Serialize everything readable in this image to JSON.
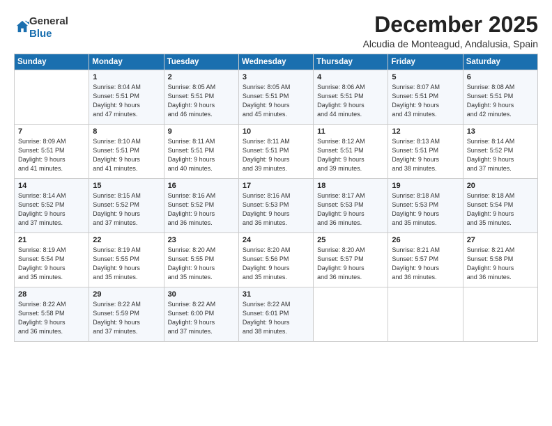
{
  "logo": {
    "general": "General",
    "blue": "Blue"
  },
  "header": {
    "month_title": "December 2025",
    "subtitle": "Alcudia de Monteagud, Andalusia, Spain"
  },
  "days_of_week": [
    "Sunday",
    "Monday",
    "Tuesday",
    "Wednesday",
    "Thursday",
    "Friday",
    "Saturday"
  ],
  "weeks": [
    [
      {
        "day": "",
        "info": ""
      },
      {
        "day": "1",
        "info": "Sunrise: 8:04 AM\nSunset: 5:51 PM\nDaylight: 9 hours\nand 47 minutes."
      },
      {
        "day": "2",
        "info": "Sunrise: 8:05 AM\nSunset: 5:51 PM\nDaylight: 9 hours\nand 46 minutes."
      },
      {
        "day": "3",
        "info": "Sunrise: 8:05 AM\nSunset: 5:51 PM\nDaylight: 9 hours\nand 45 minutes."
      },
      {
        "day": "4",
        "info": "Sunrise: 8:06 AM\nSunset: 5:51 PM\nDaylight: 9 hours\nand 44 minutes."
      },
      {
        "day": "5",
        "info": "Sunrise: 8:07 AM\nSunset: 5:51 PM\nDaylight: 9 hours\nand 43 minutes."
      },
      {
        "day": "6",
        "info": "Sunrise: 8:08 AM\nSunset: 5:51 PM\nDaylight: 9 hours\nand 42 minutes."
      }
    ],
    [
      {
        "day": "7",
        "info": "Sunrise: 8:09 AM\nSunset: 5:51 PM\nDaylight: 9 hours\nand 41 minutes."
      },
      {
        "day": "8",
        "info": "Sunrise: 8:10 AM\nSunset: 5:51 PM\nDaylight: 9 hours\nand 41 minutes."
      },
      {
        "day": "9",
        "info": "Sunrise: 8:11 AM\nSunset: 5:51 PM\nDaylight: 9 hours\nand 40 minutes."
      },
      {
        "day": "10",
        "info": "Sunrise: 8:11 AM\nSunset: 5:51 PM\nDaylight: 9 hours\nand 39 minutes."
      },
      {
        "day": "11",
        "info": "Sunrise: 8:12 AM\nSunset: 5:51 PM\nDaylight: 9 hours\nand 39 minutes."
      },
      {
        "day": "12",
        "info": "Sunrise: 8:13 AM\nSunset: 5:51 PM\nDaylight: 9 hours\nand 38 minutes."
      },
      {
        "day": "13",
        "info": "Sunrise: 8:14 AM\nSunset: 5:52 PM\nDaylight: 9 hours\nand 37 minutes."
      }
    ],
    [
      {
        "day": "14",
        "info": "Sunrise: 8:14 AM\nSunset: 5:52 PM\nDaylight: 9 hours\nand 37 minutes."
      },
      {
        "day": "15",
        "info": "Sunrise: 8:15 AM\nSunset: 5:52 PM\nDaylight: 9 hours\nand 37 minutes."
      },
      {
        "day": "16",
        "info": "Sunrise: 8:16 AM\nSunset: 5:52 PM\nDaylight: 9 hours\nand 36 minutes."
      },
      {
        "day": "17",
        "info": "Sunrise: 8:16 AM\nSunset: 5:53 PM\nDaylight: 9 hours\nand 36 minutes."
      },
      {
        "day": "18",
        "info": "Sunrise: 8:17 AM\nSunset: 5:53 PM\nDaylight: 9 hours\nand 36 minutes."
      },
      {
        "day": "19",
        "info": "Sunrise: 8:18 AM\nSunset: 5:53 PM\nDaylight: 9 hours\nand 35 minutes."
      },
      {
        "day": "20",
        "info": "Sunrise: 8:18 AM\nSunset: 5:54 PM\nDaylight: 9 hours\nand 35 minutes."
      }
    ],
    [
      {
        "day": "21",
        "info": "Sunrise: 8:19 AM\nSunset: 5:54 PM\nDaylight: 9 hours\nand 35 minutes."
      },
      {
        "day": "22",
        "info": "Sunrise: 8:19 AM\nSunset: 5:55 PM\nDaylight: 9 hours\nand 35 minutes."
      },
      {
        "day": "23",
        "info": "Sunrise: 8:20 AM\nSunset: 5:55 PM\nDaylight: 9 hours\nand 35 minutes."
      },
      {
        "day": "24",
        "info": "Sunrise: 8:20 AM\nSunset: 5:56 PM\nDaylight: 9 hours\nand 35 minutes."
      },
      {
        "day": "25",
        "info": "Sunrise: 8:20 AM\nSunset: 5:57 PM\nDaylight: 9 hours\nand 36 minutes."
      },
      {
        "day": "26",
        "info": "Sunrise: 8:21 AM\nSunset: 5:57 PM\nDaylight: 9 hours\nand 36 minutes."
      },
      {
        "day": "27",
        "info": "Sunrise: 8:21 AM\nSunset: 5:58 PM\nDaylight: 9 hours\nand 36 minutes."
      }
    ],
    [
      {
        "day": "28",
        "info": "Sunrise: 8:22 AM\nSunset: 5:58 PM\nDaylight: 9 hours\nand 36 minutes."
      },
      {
        "day": "29",
        "info": "Sunrise: 8:22 AM\nSunset: 5:59 PM\nDaylight: 9 hours\nand 37 minutes."
      },
      {
        "day": "30",
        "info": "Sunrise: 8:22 AM\nSunset: 6:00 PM\nDaylight: 9 hours\nand 37 minutes."
      },
      {
        "day": "31",
        "info": "Sunrise: 8:22 AM\nSunset: 6:01 PM\nDaylight: 9 hours\nand 38 minutes."
      },
      {
        "day": "",
        "info": ""
      },
      {
        "day": "",
        "info": ""
      },
      {
        "day": "",
        "info": ""
      }
    ]
  ]
}
